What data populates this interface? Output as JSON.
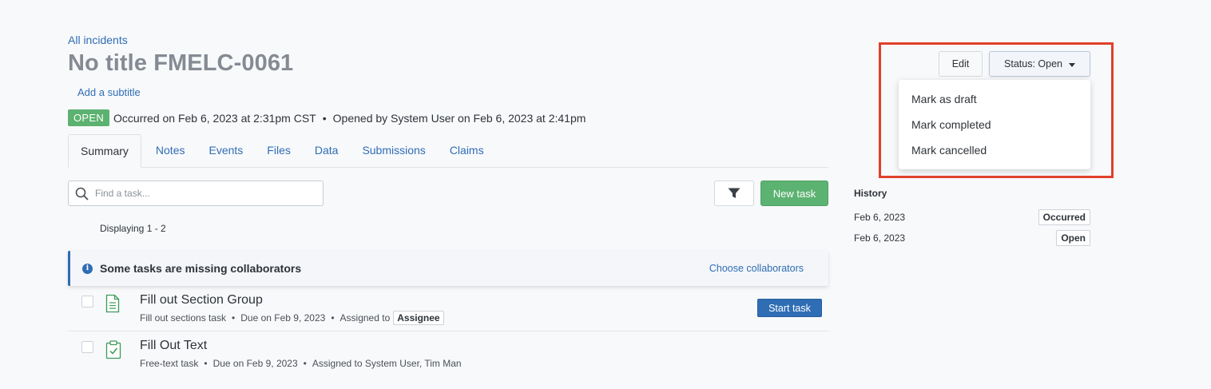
{
  "breadcrumb": "All incidents",
  "page_title": "No title FMELC-0061",
  "add_subtitle": "Add a subtitle",
  "meta": {
    "status_badge": "OPEN",
    "occurred": "Occurred on Feb 6, 2023 at 2:31pm CST",
    "separator": "•",
    "opened": "Opened by System User on Feb 6, 2023 at 2:41pm"
  },
  "tabs": [
    {
      "label": "Summary",
      "active": true
    },
    {
      "label": "Notes"
    },
    {
      "label": "Events"
    },
    {
      "label": "Files"
    },
    {
      "label": "Data"
    },
    {
      "label": "Submissions"
    },
    {
      "label": "Claims"
    }
  ],
  "search": {
    "placeholder": "Find a task..."
  },
  "new_task_label": "New task",
  "displaying": "Displaying 1 - 2",
  "alert": {
    "icon": "i",
    "text": "Some tasks are missing collaborators",
    "link": "Choose collaborators"
  },
  "tasks": [
    {
      "title": "Fill out Section Group",
      "type": "Fill out sections task",
      "due": "Due on Feb 9, 2023",
      "assigned_prefix": "Assigned to",
      "assignee": "Assignee",
      "action": "Start task",
      "icon": "document-icon"
    },
    {
      "title": "Fill Out Text",
      "type": "Free-text task",
      "due": "Due on Feb 9, 2023",
      "assigned": "Assigned to System User, Tim Man",
      "icon": "clipboard-check-icon"
    }
  ],
  "dot": "•",
  "history": {
    "title": "History",
    "rows": [
      {
        "date": "Feb 6, 2023",
        "badge": "Occurred"
      },
      {
        "date": "Feb 6, 2023",
        "badge": "Open"
      }
    ]
  },
  "header_actions": {
    "edit": "Edit",
    "status": "Status: Open"
  },
  "status_menu": [
    "Mark as draft",
    "Mark completed",
    "Mark cancelled"
  ],
  "colors": {
    "accent": "#2f6db5",
    "success": "#5cb270",
    "highlight": "#e0402a"
  }
}
